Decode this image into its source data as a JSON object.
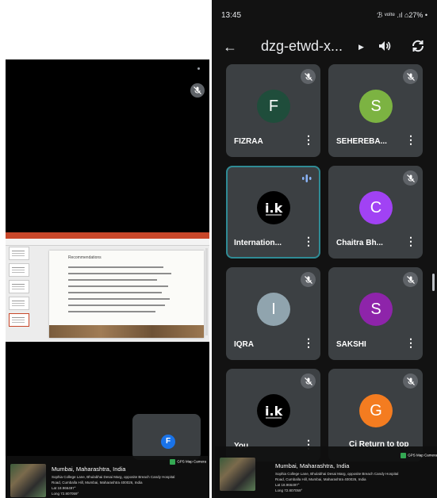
{
  "status_bar": {
    "time": "13:45",
    "right_indicators": "ℬ ᵛᵒˡᵗᵉ .ıl ⌂27% •"
  },
  "top_bar": {
    "meeting_title": "dzg-etwd-x...",
    "caret": "▶"
  },
  "tiles": [
    {
      "name": "FIZRAA",
      "initial": "F",
      "avatar_color": "#1f4d3b",
      "state": "muted"
    },
    {
      "name": "SEHEREBA...",
      "initial": "S",
      "avatar_color": "#7cb342",
      "state": "muted"
    },
    {
      "name": "Internation...",
      "initial": "",
      "avatar_color": "#000000",
      "state": "speaking",
      "logo_text": "i.k"
    },
    {
      "name": "Chaitra Bh...",
      "initial": "C",
      "avatar_color": "#a142f4",
      "state": "muted"
    },
    {
      "name": "IQRA",
      "initial": "I",
      "avatar_color": "#90a4ae",
      "state": "muted"
    },
    {
      "name": "SAKSHI",
      "initial": "S",
      "avatar_color": "#8e24aa",
      "state": "muted"
    },
    {
      "name": "You",
      "initial": "",
      "avatar_color": "#000000",
      "state": "muted",
      "logo_text": "i.k"
    },
    {
      "name": "",
      "initial": "G",
      "avatar_color": "#f47c20",
      "state": "muted"
    }
  ],
  "overlay": {
    "return_to_top": "Ci   Return to top"
  },
  "left_view": {
    "self_initial": "F",
    "slide": {
      "title": "Recommendations"
    }
  },
  "gps": {
    "badge": "GPS Map Camera",
    "city": "Mumbai, Maharashtra, India",
    "address_1": "Sophia College Lane, Bhulabhai Desai Marg, opposite Breach Candy Hospital",
    "address_2": "Road, Cumballa Hill, Mumbai, Maharashtra 400026, India",
    "lat": "Lat 18.966497°",
    "long": "Long 72.807059°"
  },
  "colors": {
    "meet_bg": "#121212",
    "tile_bg": "#3c4043",
    "speaking_border": "#2f8b95",
    "mute_badge": "#5f6368"
  }
}
